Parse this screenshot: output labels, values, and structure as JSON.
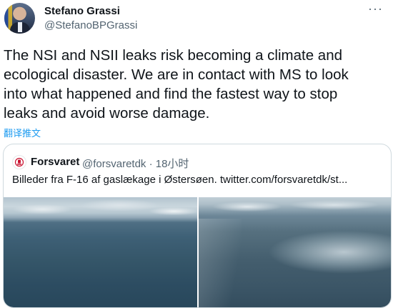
{
  "tweet": {
    "author_name": "Stefano Grassi",
    "author_handle": "@StefanoBPGrassi",
    "more_label": "···",
    "text": "The NSI and NSII leaks risk becoming a climate and\necological disaster. We are in contact with MS to look\ninto what happened and find the fastest way to stop\nleaks and avoid worse damage.",
    "translate_label": "翻译推文",
    "link_color": "#1d9bf0"
  },
  "quote": {
    "author_name": "Forsvaret",
    "author_handle": "@forsvaretdk · 18小时",
    "text": "Billeder fra F-16 af gaslækage i Østersøen.  twitter.com/forsvaretdk/st...",
    "avatar_icon": "danish-defence-crest-icon",
    "images": [
      {
        "name": "aerial-sea-photo-left",
        "description_icon": "photo"
      },
      {
        "name": "aerial-gas-leak-photo-right",
        "description_icon": "photo"
      }
    ]
  },
  "colors": {
    "text": "#0f1419",
    "secondary": "#536471",
    "border": "#cfd9de",
    "crest_red": "#c8102e"
  }
}
